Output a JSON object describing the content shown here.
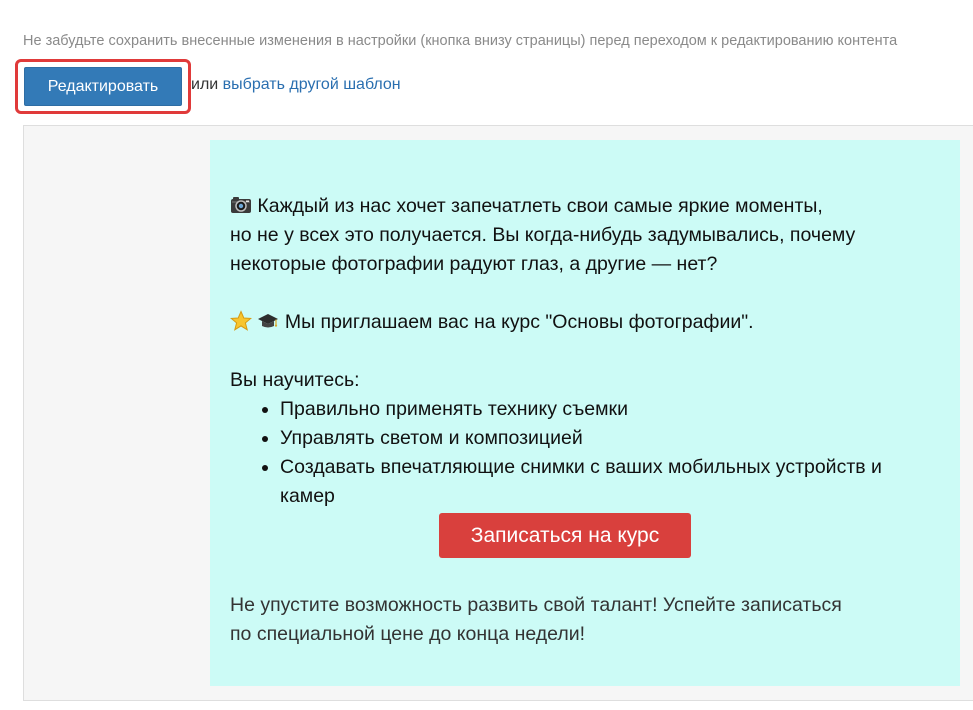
{
  "notice": {
    "text": "Не забудьте сохранить внесенные изменения в настройки (кнопка внизу страницы) перед переходом к редактированию контента"
  },
  "toolbar": {
    "edit_label": "Редактировать",
    "or_text": "или",
    "choose_template_label": "выбрать другой шаблон",
    "highlight_color": "#e03a3a",
    "button_color": "#337ab7"
  },
  "content": {
    "background_color": "#ccfbf6",
    "intro_icon": "camera-icon",
    "intro_line1": "Каждый из нас хочет запечатлеть свои самые яркие моменты,",
    "intro_line2": "но не у всех это получается. Вы когда-нибудь задумывались, почему",
    "intro_line3": "некоторые фотографии радуют глаз, а другие — нет?",
    "invite_icons": [
      "star-icon",
      "graduation-cap-icon"
    ],
    "invite_text": "Мы приглашаем вас на курс \"Основы фотографии\".",
    "learn_heading": "Вы научитесь:",
    "learn_items": [
      "Правильно применять технику съемки",
      "Управлять светом и композицией",
      "Создавать впечатляющие снимки с ваших мобильных устройств и камер"
    ],
    "cta_label": "Записаться на курс",
    "cta_color": "#d9403d",
    "closing_line1": "Не упустите возможность развить свой талант! Успейте записаться",
    "closing_line2": "по специальной цене до конца недели!"
  }
}
